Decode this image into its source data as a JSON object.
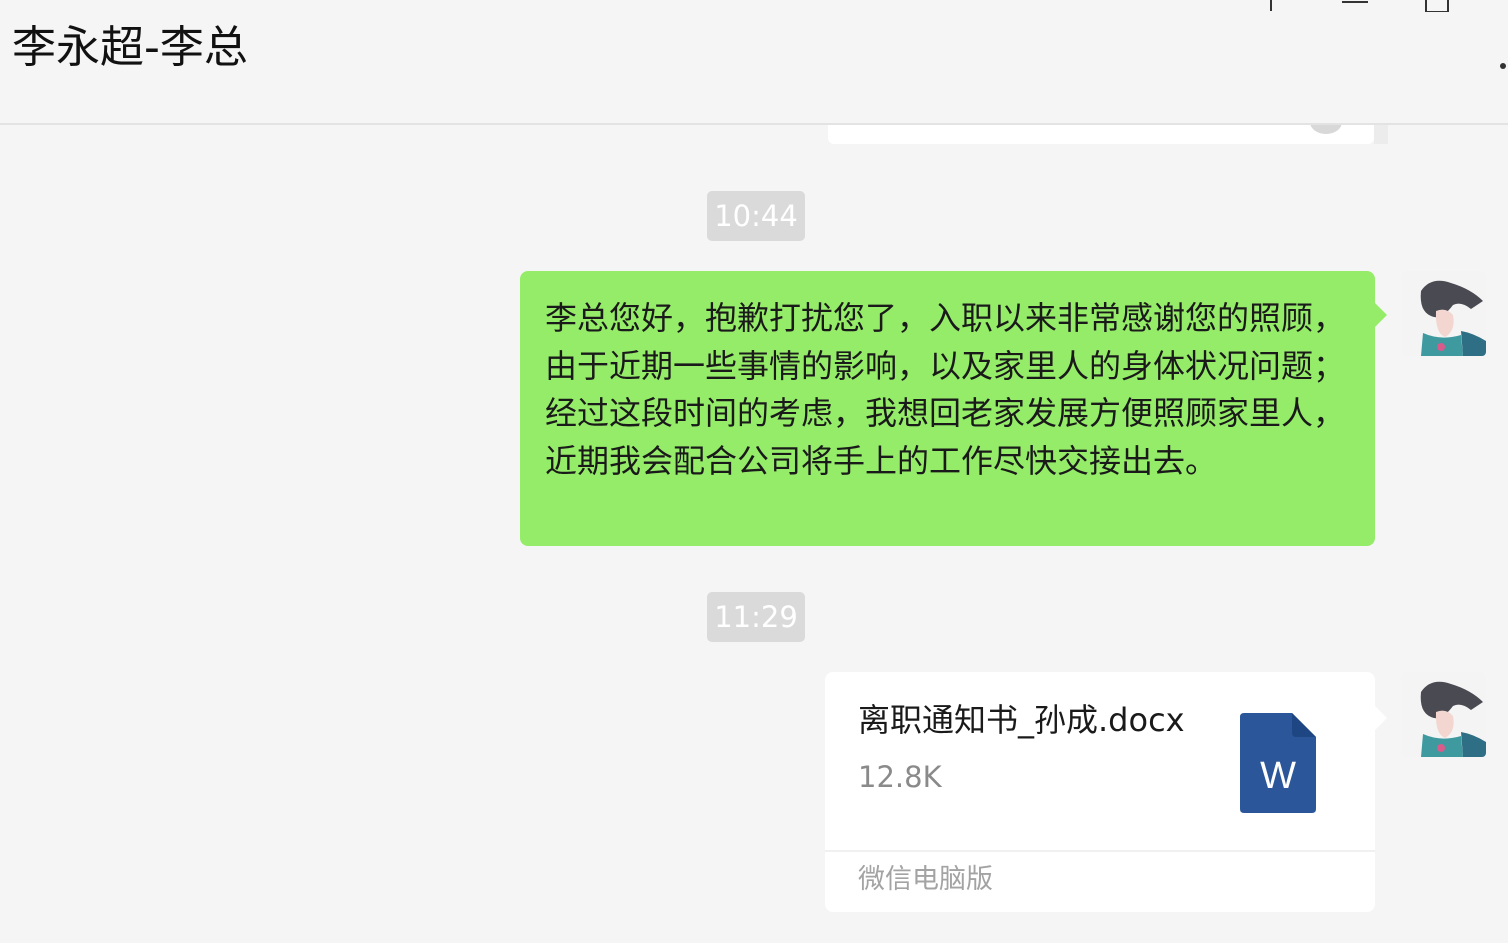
{
  "chat": {
    "title": "李永超-李总"
  },
  "window": {
    "controls": [
      "pin-icon",
      "minimize-icon",
      "maximize-icon",
      "more-icon"
    ]
  },
  "messages": {
    "time1": "10:44",
    "text1": "李总您好，抱歉打扰您了，入职以来非常感谢您的照顾，由于近期一些事情的影响，以及家里人的身体状况问题；经过这段时间的考虑，我想回老家发展方便照顾家里人，近期我会配合公司将手上的工作尽快交接出去。",
    "time2": "11:29",
    "file": {
      "name": "离职通知书_孙成.docx",
      "size": "12.8K",
      "source": "微信电脑版",
      "icon": "word-file-icon",
      "icon_letter": "W"
    }
  },
  "colors": {
    "background": "#f5f5f5",
    "self_bubble": "#95ec69",
    "timestamp_bg": "#dadada",
    "word_blue": "#2b579a"
  }
}
